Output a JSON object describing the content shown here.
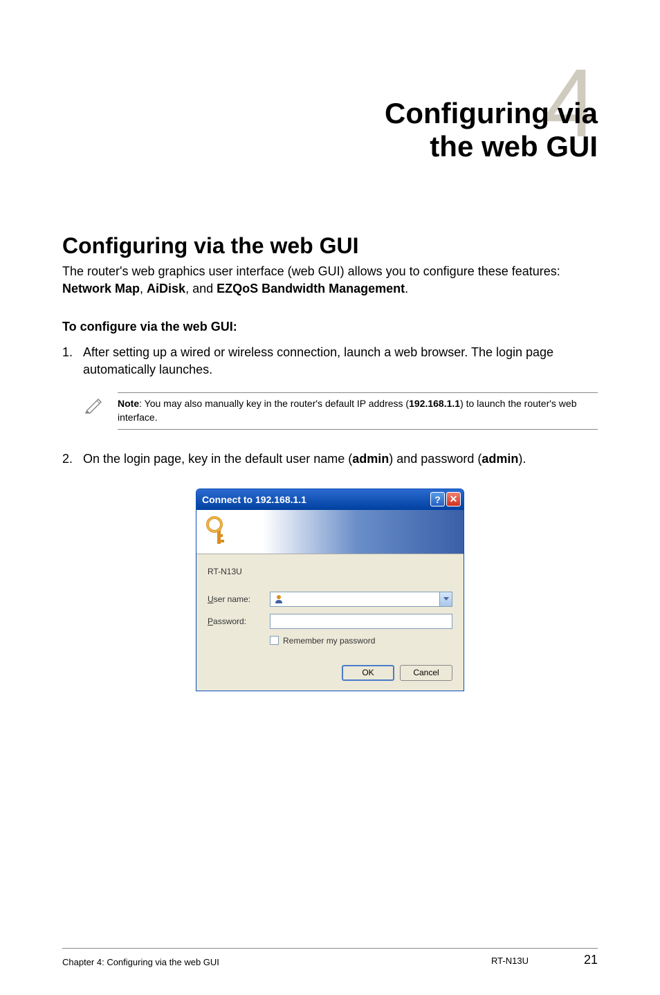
{
  "chapter": {
    "number": "4",
    "title_line1": "Configuring via",
    "title_line2": "the web GUI"
  },
  "section": {
    "heading": "Configuring via the web GUI",
    "intro_prefix": "The router's web graphics user interface (web GUI) allows you to configure these features: ",
    "feature1": "Network Map",
    "comma1": ", ",
    "feature2": "AiDisk",
    "comma2": ", and ",
    "feature3": "EZQoS Bandwidth Management",
    "period": "."
  },
  "procedure": {
    "subheading": "To configure via the web GUI:",
    "step1_num": "1.",
    "step1_text": "After setting up a wired or wireless connection, launch a web browser. The login page automatically launches.",
    "step2_num": "2.",
    "step2_text_prefix": "On the login page, key in the default user name (",
    "step2_admin1": "admin",
    "step2_text_mid": ") and password (",
    "step2_admin2": "admin",
    "step2_text_suffix": ")."
  },
  "note": {
    "label": "Note",
    "text_prefix": ": You may also manually key in the router's default IP address (",
    "ip": "192.168.1.1",
    "text_suffix": ") to launch the router's web interface."
  },
  "dialog": {
    "title": "Connect to 192.168.1.1",
    "help_symbol": "?",
    "close_symbol": "✕",
    "server": "RT-N13U",
    "username_u": "U",
    "username_rest": "ser name:",
    "password_p": "P",
    "password_rest": "assword:",
    "remember_r": "R",
    "remember_rest": "emember my password",
    "ok": "OK",
    "cancel": "Cancel"
  },
  "footer": {
    "left": "Chapter 4: Configuring via the web GUI",
    "model": "RT-N13U",
    "page": "21"
  }
}
